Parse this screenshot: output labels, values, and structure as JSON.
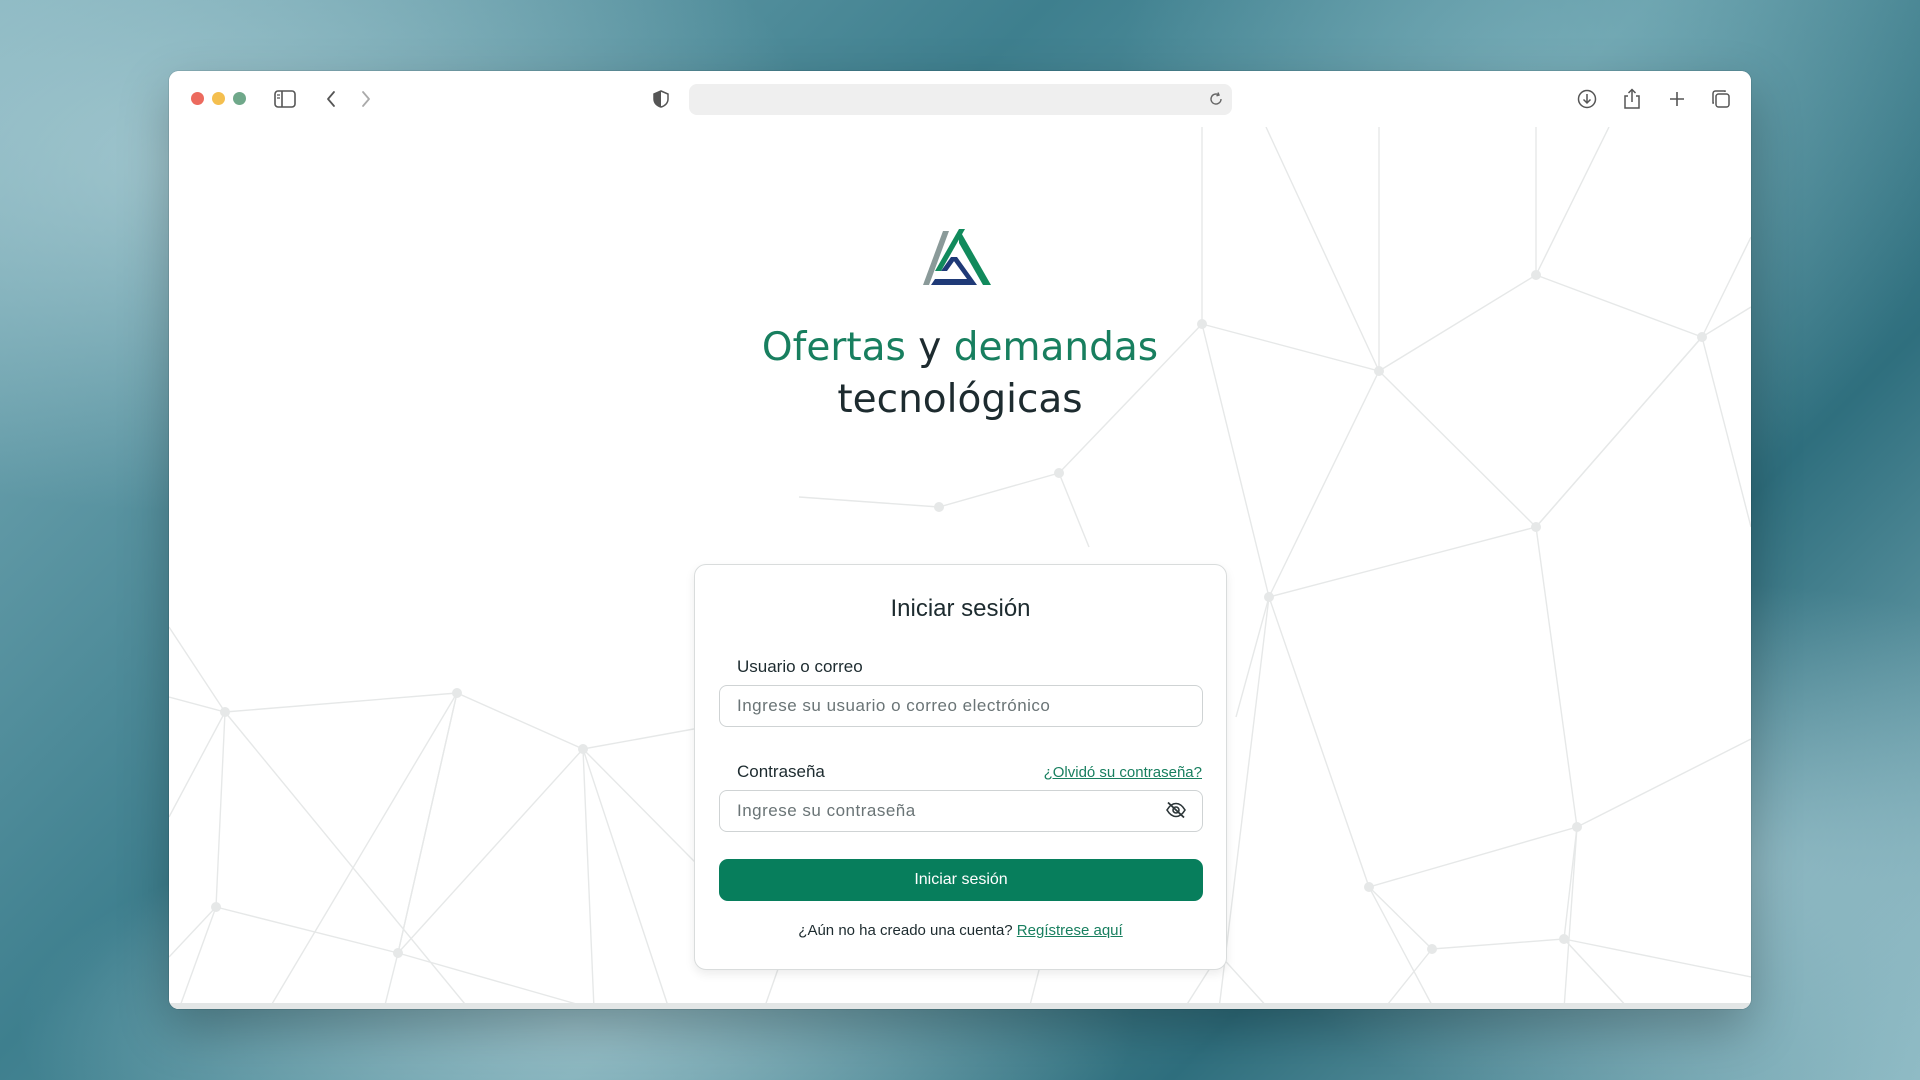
{
  "browser": {
    "address_value": "",
    "icons": [
      "sidebar-icon",
      "back-icon",
      "forward-icon",
      "shield-icon",
      "reload-icon",
      "download-icon",
      "share-icon",
      "new-tab-icon",
      "tabs-overview-icon"
    ]
  },
  "page": {
    "headline": {
      "part1": "Ofertas",
      "part2": " y ",
      "part3": "demandas",
      "line2": "tecnológicas"
    }
  },
  "login": {
    "title": "Iniciar sesión",
    "username_label": "Usuario o correo",
    "username_placeholder": "Ingrese su usuario o correo electrónico",
    "username_value": "",
    "password_label": "Contraseña",
    "forgot_link": "¿Olvidó su contraseña?",
    "password_placeholder": "Ingrese su contraseña",
    "password_value": "",
    "submit_label": "Iniciar sesión",
    "register_prompt": "¿Aún no ha creado una cuenta? ",
    "register_link": "Regístrese aquí"
  },
  "colors": {
    "brand_green": "#077e5c",
    "headline_green": "#187f5f",
    "logo_navy": "#1f3a77",
    "logo_gray": "#8a9a99"
  }
}
